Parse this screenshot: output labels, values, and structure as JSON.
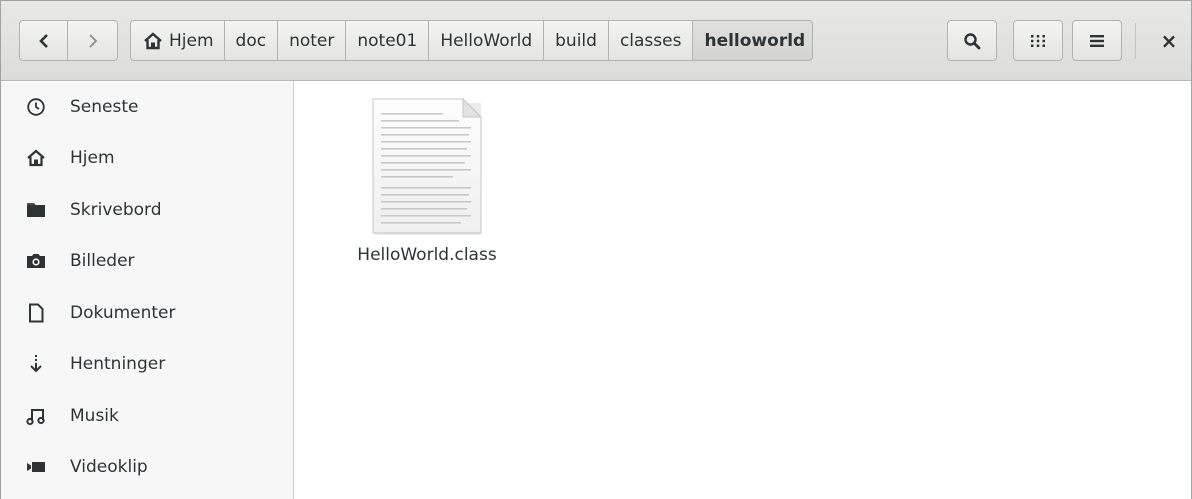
{
  "header": {
    "back_icon": "chevron-left-icon",
    "forward_icon": "chevron-right-icon",
    "path": [
      {
        "label": "Hjem",
        "icon": "home-icon"
      },
      {
        "label": "doc"
      },
      {
        "label": "noter"
      },
      {
        "label": "note01"
      },
      {
        "label": "HelloWorld"
      },
      {
        "label": "build"
      },
      {
        "label": "classes"
      },
      {
        "label": "helloworld",
        "active": true
      }
    ],
    "search_icon": "search-icon",
    "grid_view_icon": "grid-view-icon",
    "menu_icon": "menu-icon",
    "close_label": "×"
  },
  "sidebar": {
    "items": [
      {
        "label": "Seneste",
        "icon": "clock-icon"
      },
      {
        "label": "Hjem",
        "icon": "home-icon"
      },
      {
        "label": "Skrivebord",
        "icon": "folder-icon"
      },
      {
        "label": "Billeder",
        "icon": "camera-icon"
      },
      {
        "label": "Dokumenter",
        "icon": "document-icon"
      },
      {
        "label": "Hentninger",
        "icon": "download-icon"
      },
      {
        "label": "Musik",
        "icon": "music-icon"
      },
      {
        "label": "Videoklip",
        "icon": "video-icon"
      }
    ]
  },
  "files": [
    {
      "name": "HelloWorld.class",
      "icon": "text-file-icon"
    }
  ]
}
